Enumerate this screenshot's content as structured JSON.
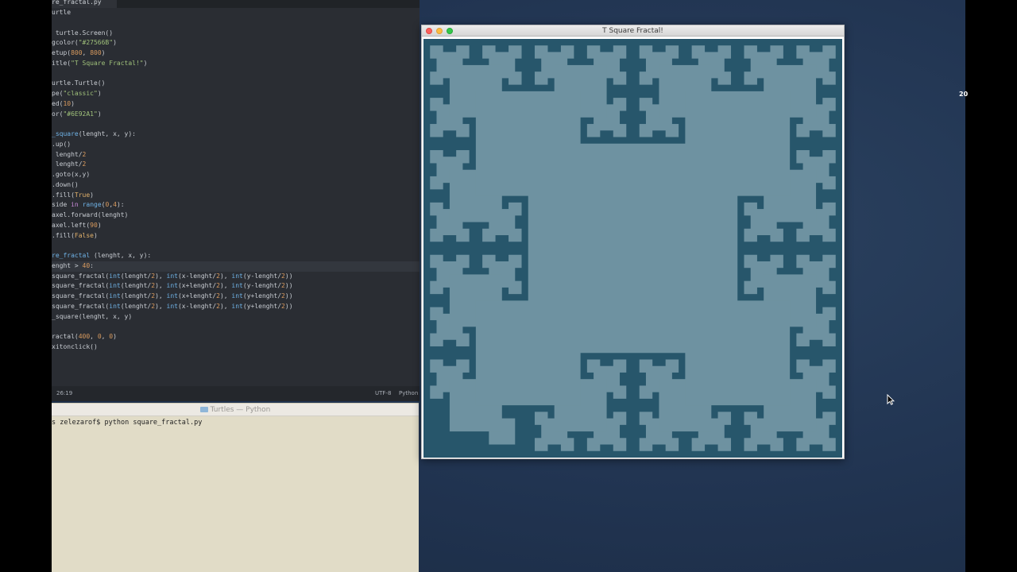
{
  "editor": {
    "tab_title": "re_fractal.py",
    "lines": [
      [
        {
          "t": "urtle"
        }
      ],
      [
        {
          "t": ""
        }
      ],
      [
        {
          "t": " turtle.Screen()"
        }
      ],
      [
        {
          "t": "gcolor("
        },
        {
          "t": "\"#27566B\"",
          "c": "cs"
        },
        {
          "t": ")"
        }
      ],
      [
        {
          "t": "etup("
        },
        {
          "t": "800",
          "c": "cn"
        },
        {
          "t": ", "
        },
        {
          "t": "800",
          "c": "cn"
        },
        {
          "t": ")"
        }
      ],
      [
        {
          "t": "itle("
        },
        {
          "t": "\"T Square Fractal!\"",
          "c": "cs"
        },
        {
          "t": ")"
        }
      ],
      [
        {
          "t": ""
        }
      ],
      [
        {
          "t": "urtle.Turtle()"
        }
      ],
      [
        {
          "t": "pe("
        },
        {
          "t": "\"classic\"",
          "c": "cs"
        },
        {
          "t": ")"
        }
      ],
      [
        {
          "t": "ed("
        },
        {
          "t": "10",
          "c": "cn"
        },
        {
          "t": ")"
        }
      ],
      [
        {
          "t": "or("
        },
        {
          "t": "\"#6E92A1\"",
          "c": "cs"
        },
        {
          "t": ")"
        }
      ],
      [
        {
          "t": ""
        }
      ],
      [
        {
          "t": "_square",
          "c": "cf"
        },
        {
          "t": "(lenght, x, y):"
        }
      ],
      [
        {
          "t": ".up()"
        }
      ],
      [
        {
          "t": " lenght/"
        },
        {
          "t": "2",
          "c": "cn"
        }
      ],
      [
        {
          "t": " lenght/"
        },
        {
          "t": "2",
          "c": "cn"
        }
      ],
      [
        {
          "t": ".goto(x,y)"
        }
      ],
      [
        {
          "t": ".down()"
        }
      ],
      [
        {
          "t": ".fill("
        },
        {
          "t": "True",
          "c": "cp"
        },
        {
          "t": ")"
        }
      ],
      [
        {
          "t": "side "
        },
        {
          "t": "in",
          "c": "ck"
        },
        {
          "t": " "
        },
        {
          "t": "range",
          "c": "cf"
        },
        {
          "t": "("
        },
        {
          "t": "0",
          "c": "cn"
        },
        {
          "t": ","
        },
        {
          "t": "4",
          "c": "cn"
        },
        {
          "t": "):"
        }
      ],
      [
        {
          "t": "axel.forward(lenght)"
        }
      ],
      [
        {
          "t": "axel.left("
        },
        {
          "t": "90",
          "c": "cn"
        },
        {
          "t": ")"
        }
      ],
      [
        {
          "t": ".fill("
        },
        {
          "t": "False",
          "c": "cp"
        },
        {
          "t": ")"
        }
      ],
      [
        {
          "t": ""
        }
      ],
      [
        {
          "t": "re_fractal",
          "c": "cf"
        },
        {
          "t": " (lenght, x, y):"
        }
      ],
      [
        {
          "t": "enght > "
        },
        {
          "t": "40",
          "c": "cn"
        },
        {
          "t": ":"
        }
      ],
      [
        {
          "t": "square_fractal("
        },
        {
          "t": "int",
          "c": "cf"
        },
        {
          "t": "(lenght/"
        },
        {
          "t": "2",
          "c": "cn"
        },
        {
          "t": "), "
        },
        {
          "t": "int",
          "c": "cf"
        },
        {
          "t": "(x-lenght/"
        },
        {
          "t": "2",
          "c": "cn"
        },
        {
          "t": "), "
        },
        {
          "t": "int",
          "c": "cf"
        },
        {
          "t": "(y-lenght/"
        },
        {
          "t": "2",
          "c": "cn"
        },
        {
          "t": "))"
        }
      ],
      [
        {
          "t": "square_fractal("
        },
        {
          "t": "int",
          "c": "cf"
        },
        {
          "t": "(lenght/"
        },
        {
          "t": "2",
          "c": "cn"
        },
        {
          "t": "), "
        },
        {
          "t": "int",
          "c": "cf"
        },
        {
          "t": "(x+lenght/"
        },
        {
          "t": "2",
          "c": "cn"
        },
        {
          "t": "), "
        },
        {
          "t": "int",
          "c": "cf"
        },
        {
          "t": "(y-lenght/"
        },
        {
          "t": "2",
          "c": "cn"
        },
        {
          "t": "))"
        }
      ],
      [
        {
          "t": "square_fractal("
        },
        {
          "t": "int",
          "c": "cf"
        },
        {
          "t": "(lenght/"
        },
        {
          "t": "2",
          "c": "cn"
        },
        {
          "t": "), "
        },
        {
          "t": "int",
          "c": "cf"
        },
        {
          "t": "(x+lenght/"
        },
        {
          "t": "2",
          "c": "cn"
        },
        {
          "t": "), "
        },
        {
          "t": "int",
          "c": "cf"
        },
        {
          "t": "(y+lenght/"
        },
        {
          "t": "2",
          "c": "cn"
        },
        {
          "t": "))"
        }
      ],
      [
        {
          "t": "square_fractal("
        },
        {
          "t": "int",
          "c": "cf"
        },
        {
          "t": "(lenght/"
        },
        {
          "t": "2",
          "c": "cn"
        },
        {
          "t": "), "
        },
        {
          "t": "int",
          "c": "cf"
        },
        {
          "t": "(x-lenght/"
        },
        {
          "t": "2",
          "c": "cn"
        },
        {
          "t": "), "
        },
        {
          "t": "int",
          "c": "cf"
        },
        {
          "t": "(y+lenght/"
        },
        {
          "t": "2",
          "c": "cn"
        },
        {
          "t": "))"
        }
      ],
      [
        {
          "t": "_square(lenght, x, y)"
        }
      ],
      [
        {
          "t": ""
        }
      ],
      [
        {
          "t": "ractal("
        },
        {
          "t": "400",
          "c": "cn"
        },
        {
          "t": ", "
        },
        {
          "t": "0",
          "c": "cn"
        },
        {
          "t": ", "
        },
        {
          "t": "0",
          "c": "cn"
        },
        {
          "t": ")"
        }
      ],
      [
        {
          "t": "xitonclick()"
        }
      ]
    ],
    "status": {
      "cursor_position": "26:19",
      "encoding": "UTF-8",
      "language": "Python"
    }
  },
  "terminal": {
    "title": "Turtles — Python",
    "command_line": "s zelezarof$ python square_fractal.py"
  },
  "turtle_window": {
    "title": "T Square Fractal!",
    "background_color": "#27566B",
    "fill_color": "#6E92A1",
    "fractal_initial_length": 400,
    "fractal_min_length": 40
  },
  "desktop": {
    "clock_fragment": "20"
  }
}
